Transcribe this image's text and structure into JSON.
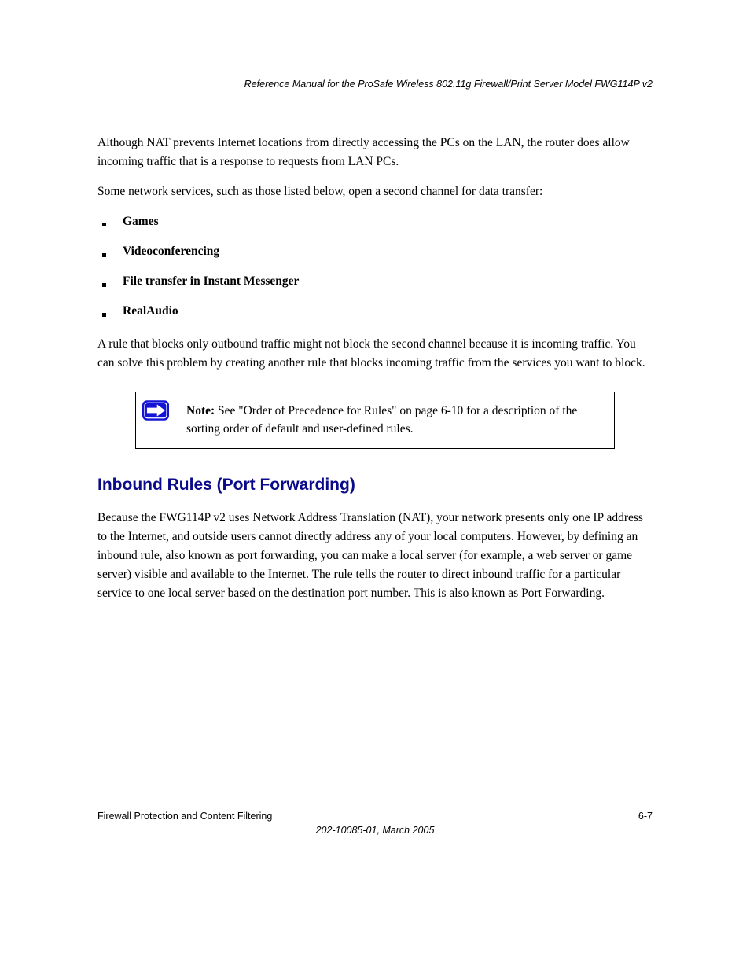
{
  "header": {
    "manual_title": "Reference Manual for the ProSafe Wireless 802.11g  Firewall/Print Server Model FWG114P v2"
  },
  "content": {
    "p1": "Although NAT prevents Internet locations from directly accessing the PCs on the LAN, the router does allow incoming traffic that is a response to requests from LAN PCs.",
    "p2": "Some network services, such as those listed below, open a second channel for data transfer:",
    "items": [
      {
        "lead": "Games",
        "rest": ""
      },
      {
        "lead": "Videoconferencing",
        "rest": ""
      },
      {
        "lead": "File transfer in Instant Messenger",
        "rest": ""
      },
      {
        "lead": "RealAudio",
        "rest": ""
      }
    ],
    "p3": "A rule that blocks only outbound traffic might not block the second channel because it is incoming traffic. You can solve this problem by creating another rule that blocks incoming traffic from the services you want to block.",
    "note": {
      "lead": "Note:",
      "text": " See \"Order of Precedence for Rules\" on page 6-10 for a description of the sorting order of default and user-defined rules."
    },
    "section_heading": "Inbound Rules (Port Forwarding)",
    "p4": "Because the FWG114P v2 uses Network Address Translation (NAT), your network presents only one IP address to the Internet, and outside users cannot directly address any of your local computers. However, by defining an inbound rule, also known as port forwarding, you can make a local server (for example, a web server or game server) visible and available to the Internet. The rule tells the router to direct inbound traffic for a particular service to one local server based on the destination port number. This is also known as Port Forwarding."
  },
  "footer": {
    "left": "Firewall Protection and Content Filtering",
    "right": "6-7",
    "mid": "202-10085-01,  March 2005"
  },
  "icons": {
    "note_arrow": "arrow-right-icon"
  }
}
